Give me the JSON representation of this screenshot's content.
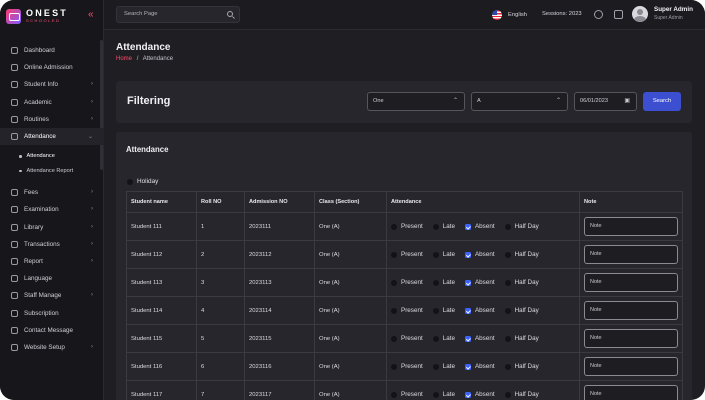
{
  "brand": {
    "name": "ONEST",
    "sub": "SCHOOLED"
  },
  "sidebar": {
    "items": [
      {
        "label": "Dashboard",
        "icon": "dashboard-icon"
      },
      {
        "label": "Online Admission",
        "icon": "user-icon"
      },
      {
        "label": "Student Info",
        "icon": "student-icon",
        "chevron": "›"
      },
      {
        "label": "Academic",
        "icon": "academic-icon",
        "chevron": "›"
      },
      {
        "label": "Routines",
        "icon": "calendar-icon",
        "chevron": "›"
      },
      {
        "label": "Attendance",
        "icon": "attendance-icon",
        "chevron": "⌄",
        "active": true
      },
      {
        "label": "Fees",
        "icon": "fees-icon",
        "chevron": "›"
      },
      {
        "label": "Examination",
        "icon": "exam-icon",
        "chevron": "›"
      },
      {
        "label": "Library",
        "icon": "library-icon",
        "chevron": "›"
      },
      {
        "label": "Transactions",
        "icon": "transactions-icon",
        "chevron": "›"
      },
      {
        "label": "Report",
        "icon": "report-icon",
        "chevron": "›"
      },
      {
        "label": "Language",
        "icon": "language-icon"
      },
      {
        "label": "Staff Manage",
        "icon": "staff-icon",
        "chevron": "›"
      },
      {
        "label": "Subscription",
        "icon": "subscription-icon"
      },
      {
        "label": "Contact Message",
        "icon": "message-icon"
      },
      {
        "label": "Website Setup",
        "icon": "website-icon",
        "chevron": "›"
      }
    ],
    "sub_items": [
      {
        "label": "Attendance",
        "active": true
      },
      {
        "label": "Attendance Report"
      }
    ]
  },
  "topbar": {
    "search_placeholder": "Search Page",
    "language": "English",
    "session": "Sessions: 2023",
    "user_name": "Super Admin",
    "user_role": "Super Admin"
  },
  "page": {
    "title": "Attendance",
    "breadcrumb_home": "Home",
    "breadcrumb_sep": "/",
    "breadcrumb_current": "Attendance"
  },
  "filter": {
    "title": "Filtering",
    "class_value": "One",
    "section_value": "A",
    "date_value": "06/01/2023",
    "search_label": "Search"
  },
  "attendance": {
    "title": "Attendance",
    "holiday_label": "Holiday",
    "columns": [
      "Student name",
      "Roll NO",
      "Admission NO",
      "Class (Section)",
      "Attendance",
      "Note"
    ],
    "options": [
      "Present",
      "Late",
      "Absent",
      "Half Day"
    ],
    "note_placeholder": "Note",
    "rows": [
      {
        "name": "Student 111",
        "roll": "1",
        "admission": "2023111",
        "class": "One (A)"
      },
      {
        "name": "Student 112",
        "roll": "2",
        "admission": "2023112",
        "class": "One (A)"
      },
      {
        "name": "Student 113",
        "roll": "3",
        "admission": "2023113",
        "class": "One (A)"
      },
      {
        "name": "Student 114",
        "roll": "4",
        "admission": "2023114",
        "class": "One (A)"
      },
      {
        "name": "Student 115",
        "roll": "5",
        "admission": "2023115",
        "class": "One (A)"
      },
      {
        "name": "Student 116",
        "roll": "6",
        "admission": "2023116",
        "class": "One (A)"
      },
      {
        "name": "Student 117",
        "roll": "7",
        "admission": "2023117",
        "class": "One (A)"
      }
    ]
  }
}
